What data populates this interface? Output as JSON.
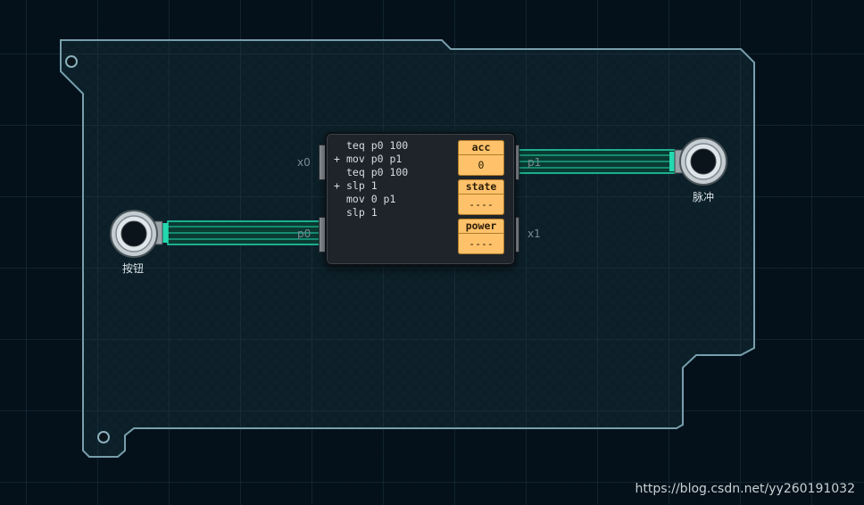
{
  "board": {
    "pins": {
      "x0": "x0",
      "p0": "p0",
      "p1": "p1",
      "x1": "x1"
    },
    "components": {
      "button_label": "按钮",
      "pulse_label": "脉冲"
    }
  },
  "controller": {
    "code": [
      {
        "prefix": "",
        "text": "teq p0 100"
      },
      {
        "prefix": "+",
        "text": "mov p0 p1"
      },
      {
        "prefix": "",
        "text": "teq p0 100"
      },
      {
        "prefix": "+",
        "text": "slp 1"
      },
      {
        "prefix": "",
        "text": "mov 0 p1"
      },
      {
        "prefix": "",
        "text": "slp 1"
      }
    ],
    "registers": [
      {
        "name": "acc",
        "value": "0"
      },
      {
        "name": "state",
        "value": "----"
      },
      {
        "name": "power",
        "value": "----"
      }
    ]
  },
  "colors": {
    "wire": "#23d9b0",
    "register": "#ffc26a",
    "board_outline": "#7fa6b4"
  },
  "watermark": "https://blog.csdn.net/yy260191032"
}
